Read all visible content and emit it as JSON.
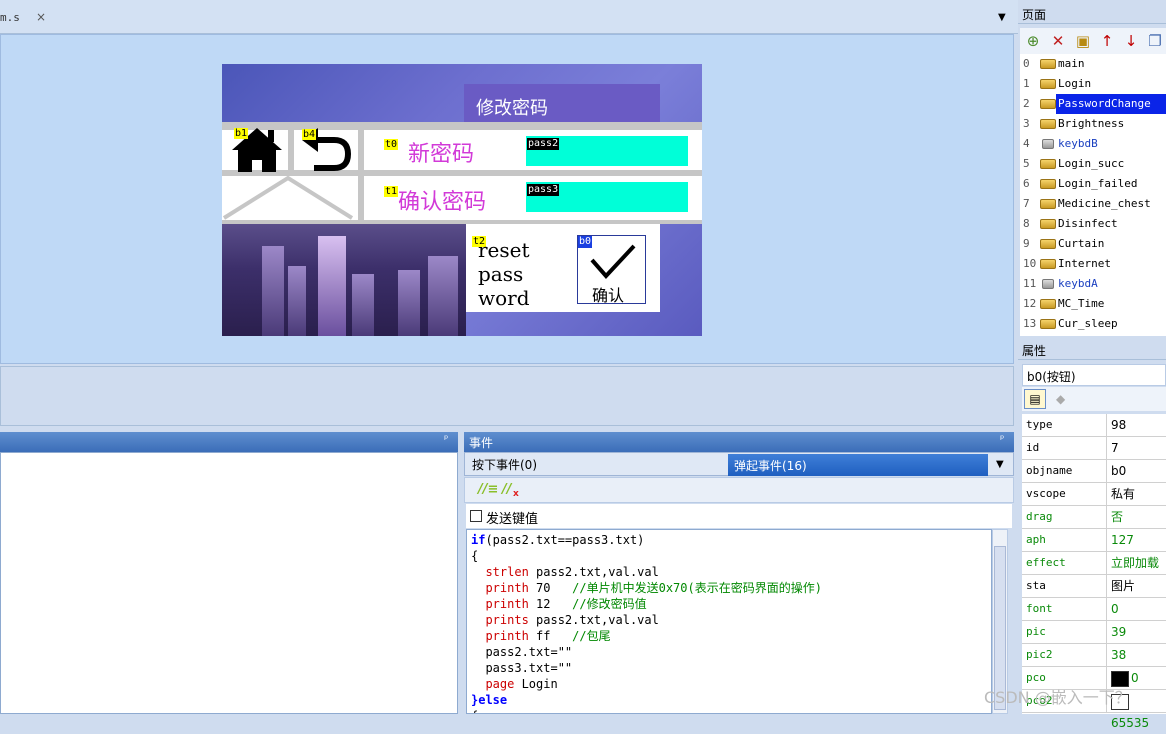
{
  "top": {
    "tab_file": "m.s",
    "tab_close": "×"
  },
  "hmi": {
    "title": "修改密码",
    "tag_b1": "b1",
    "tag_b4": "b4",
    "tag_t0": "t0",
    "tag_t1": "t1",
    "tag_t2": "t2",
    "tag_b0": "b0",
    "new_pw_label": "新密码",
    "confirm_pw_label": "确认密码",
    "pass2_name": "pass2",
    "pass3_name": "pass3",
    "reset_text": "reset pass word",
    "ok_label": "确认"
  },
  "events": {
    "header": "事件",
    "tab_press": "按下事件(0)",
    "tab_release": "弹起事件(16)",
    "send_key_label": "发送键值",
    "code": [
      {
        "k": "if",
        "r": "(pass2.txt==pass3.txt)"
      },
      {
        "r": "{"
      },
      {
        "f": "  strlen",
        "r": " pass2.txt,val.val"
      },
      {
        "f": "  printh",
        "r": " 70   ",
        "c": "//单片机中发送0x70(表示在密码界面的操作)"
      },
      {
        "f": "  printh",
        "r": " 12   ",
        "c": "//修改密码值"
      },
      {
        "f": "  prints",
        "r": " pass2.txt,val.val"
      },
      {
        "f": "  printh",
        "r": " ff   ",
        "c": "//包尾"
      },
      {
        "r": "  pass2.txt=\"\""
      },
      {
        "r": "  pass3.txt=\"\""
      },
      {
        "f": "  page",
        "r": " Login"
      },
      {
        "k": "}else",
        "r": ""
      },
      {
        "r": "{"
      }
    ]
  },
  "pages": {
    "header": "页面",
    "items": [
      {
        "n": "0",
        "t": "main"
      },
      {
        "n": "1",
        "t": "Login"
      },
      {
        "n": "2",
        "t": "PasswordChange",
        "sel": true
      },
      {
        "n": "3",
        "t": "Brightness"
      },
      {
        "n": "4",
        "t": "keybdB",
        "lock": true
      },
      {
        "n": "5",
        "t": "Login_succ"
      },
      {
        "n": "6",
        "t": "Login_failed"
      },
      {
        "n": "7",
        "t": "Medicine_chest"
      },
      {
        "n": "8",
        "t": "Disinfect"
      },
      {
        "n": "9",
        "t": "Curtain"
      },
      {
        "n": "10",
        "t": "Internet"
      },
      {
        "n": "11",
        "t": "keybdA",
        "lock": true
      },
      {
        "n": "12",
        "t": "MC_Time"
      },
      {
        "n": "13",
        "t": "Cur_sleep"
      }
    ]
  },
  "attrs": {
    "header": "属性",
    "selected": "b0(按钮)",
    "rows": [
      {
        "k": "type",
        "v": "98"
      },
      {
        "k": "id",
        "v": "7"
      },
      {
        "k": "objname",
        "v": "b0"
      },
      {
        "k": "vscope",
        "v": "私有"
      },
      {
        "k": "drag",
        "v": "否",
        "g": true
      },
      {
        "k": "aph",
        "v": "127",
        "g": true
      },
      {
        "k": "effect",
        "v": "立即加载",
        "g": true
      },
      {
        "k": "sta",
        "v": "图片"
      },
      {
        "k": "font",
        "v": "0",
        "g": true
      },
      {
        "k": "pic",
        "v": "39",
        "g": true
      },
      {
        "k": "pic2",
        "v": "38",
        "g": true
      },
      {
        "k": "pco",
        "v": "0",
        "g": true,
        "sw": "#000000"
      },
      {
        "k": "pco2",
        "v": "65535",
        "g": true,
        "sw": "#ffffff"
      }
    ]
  },
  "watermark": "CSDN @嵌入一下？"
}
